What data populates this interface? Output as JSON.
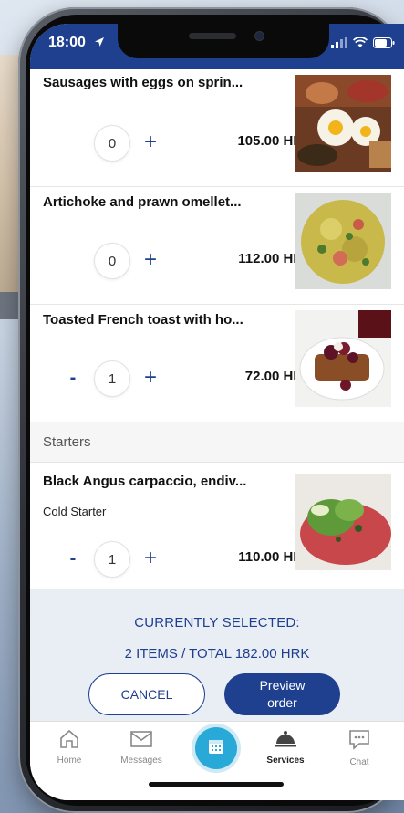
{
  "status_bar": {
    "time": "18:00"
  },
  "menu": {
    "items": [
      {
        "name": "Sausages with eggs on sprin...",
        "qty": "0",
        "price": "105.00 HRK",
        "show_minus": false,
        "image_icon": "breakfast-plate-photo"
      },
      {
        "name": "Artichoke and prawn omellet...",
        "qty": "0",
        "price": "112.00 HRK",
        "show_minus": false,
        "image_icon": "omelette-photo"
      },
      {
        "name": "Toasted French toast with ho...",
        "qty": "1",
        "price": "72.00 HRK",
        "show_minus": true,
        "image_icon": "french-toast-photo"
      }
    ],
    "section": {
      "label": "Starters"
    },
    "starter_item": {
      "name": "Black Angus carpaccio, endiv...",
      "subtitle": "Cold Starter",
      "qty": "1",
      "price": "110.00 HRK",
      "show_minus": true,
      "image_icon": "carpaccio-photo"
    },
    "minus_symbol": "-",
    "plus_symbol": "+"
  },
  "selection": {
    "title": "CURRENTLY SELECTED:",
    "total": "2 ITEMS / TOTAL 182.00 HRK",
    "cancel_label": "CANCEL",
    "preview_label": "Preview order"
  },
  "tabs": [
    {
      "label": "Home",
      "icon": "home-icon",
      "active": false
    },
    {
      "label": "Messages",
      "icon": "envelope-icon",
      "active": false
    },
    {
      "label": "",
      "icon": "calendar-icon",
      "active": false
    },
    {
      "label": "Services",
      "icon": "cloche-icon",
      "active": true
    },
    {
      "label": "Chat",
      "icon": "chat-bubble-icon",
      "active": false
    }
  ],
  "colors": {
    "brand": "#1f3f8f",
    "accent": "#29a9d8",
    "footer_bg": "#e9eef5"
  }
}
